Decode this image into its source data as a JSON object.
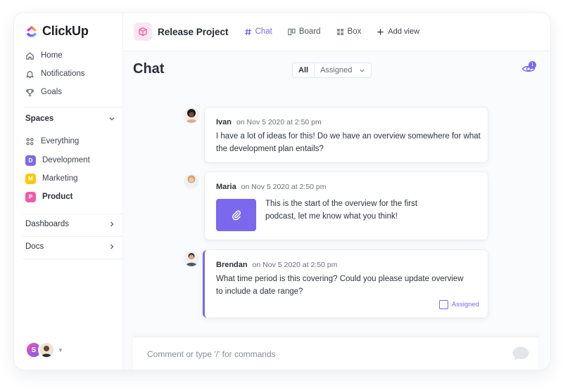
{
  "app": {
    "name": "ClickUp"
  },
  "sidebar": {
    "nav": [
      {
        "label": "Home",
        "icon": "home-icon"
      },
      {
        "label": "Notifications",
        "icon": "bell-icon"
      },
      {
        "label": "Goals",
        "icon": "trophy-icon"
      }
    ],
    "spaces_title": "Spaces",
    "everything_label": "Everything",
    "spaces": [
      {
        "letter": "D",
        "label": "Development",
        "color": "#7b68ee"
      },
      {
        "letter": "M",
        "label": "Marketing",
        "color": "#ffc800"
      },
      {
        "letter": "P",
        "label": "Product",
        "color": "#f15ba8"
      }
    ],
    "dashboards_label": "Dashboards",
    "docs_label": "Docs",
    "user_initial": "S"
  },
  "topbar": {
    "project_title": "Release Project",
    "views": [
      {
        "label": "Chat",
        "icon": "hash-icon",
        "active": true
      },
      {
        "label": "Board",
        "icon": "board-icon"
      },
      {
        "label": "Box",
        "icon": "grid-icon"
      },
      {
        "label": "Add view",
        "icon": "plus-icon"
      }
    ]
  },
  "main": {
    "title": "Chat",
    "filter_all": "All",
    "filter_assigned": "Assigned",
    "watchers_count": "1"
  },
  "messages": [
    {
      "author": "Ivan",
      "time": "on Nov 5 2020 at 2:50 pm",
      "text": "I have a lot of ideas for this! Do we have an overview somewhere for what the development plan entails?"
    },
    {
      "author": "Maria",
      "time": "on Nov 5 2020 at 2:50 pm",
      "text": "This is the start of the overview for the first podcast, let me know what you think!"
    },
    {
      "author": "Brendan",
      "time": "on Nov 5 2020 at 2:50 pm",
      "text": "What time period is this covering? Could you please update overview to include a date range?",
      "tag": "Assigned"
    }
  ],
  "comment": {
    "placeholder": "Comment or type '/' for commands"
  },
  "colors": {
    "accent": "#7b68ee"
  }
}
